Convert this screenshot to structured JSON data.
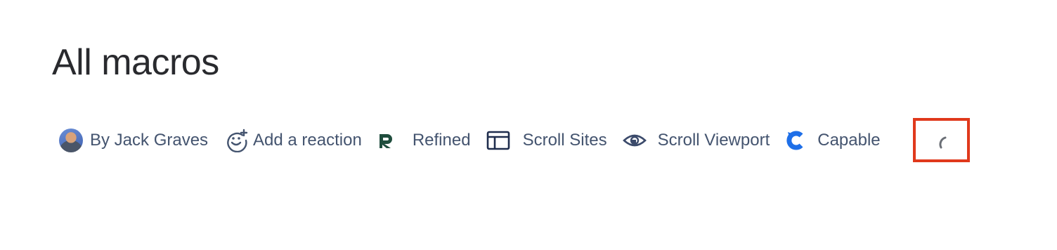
{
  "page": {
    "title": "All macros"
  },
  "byline": {
    "author_label": "By Jack Graves",
    "reaction_label": "Add a reaction"
  },
  "apps": [
    {
      "label": "Refined",
      "icon": "refined-logo-icon"
    },
    {
      "label": "Scroll Sites",
      "icon": "layout-icon"
    },
    {
      "label": "Scroll Viewport",
      "icon": "eye-icon"
    },
    {
      "label": "Capable",
      "icon": "capable-logo-icon"
    }
  ],
  "colors": {
    "highlight_border": "#e0391c",
    "refined_brand": "#1f4d3d",
    "capable_brand": "#1e6fe8",
    "text_secondary": "#44546f"
  }
}
